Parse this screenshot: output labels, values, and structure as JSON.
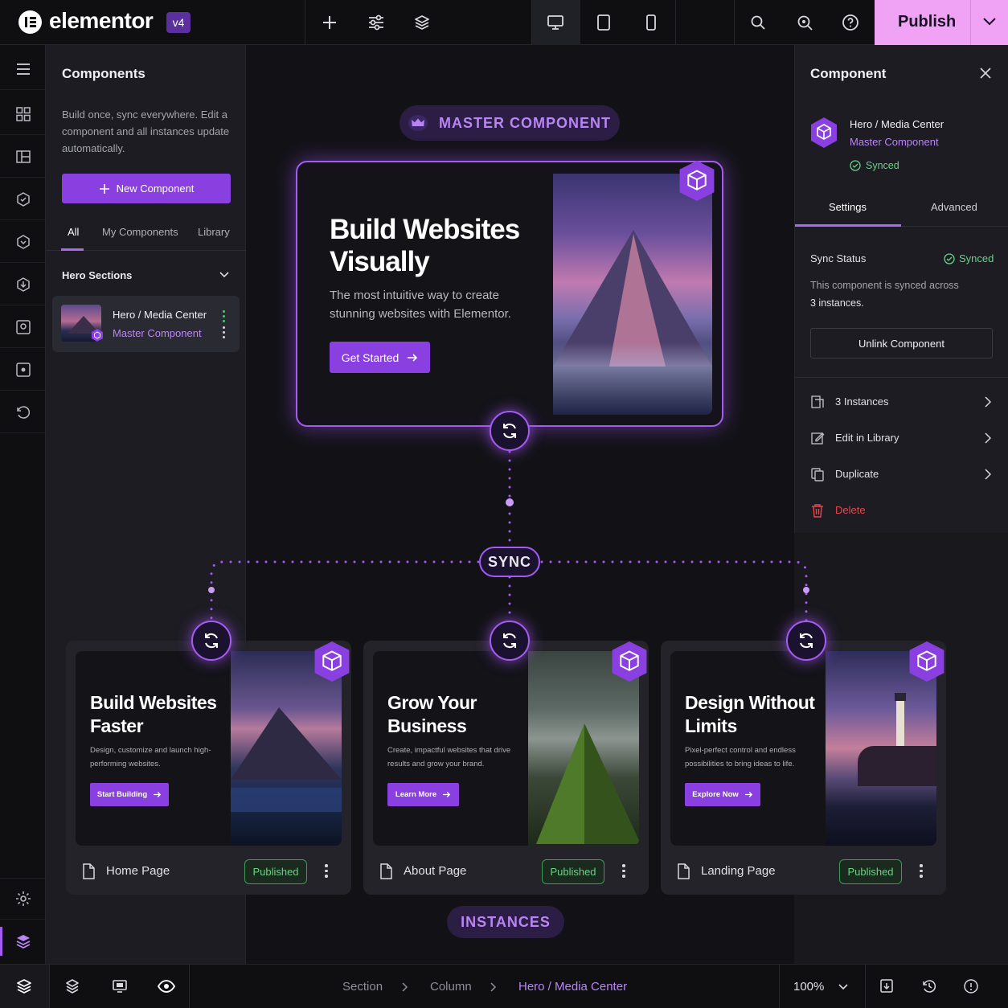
{
  "topbar": {
    "brand": "elementor",
    "version": "v4",
    "publish_label": "Publish"
  },
  "panel": {
    "title": "Components",
    "description": "Build once, sync everywhere. Edit a component and all instances update automatically.",
    "new_button": "New Component",
    "tabs": [
      "All",
      "My Components",
      "Library"
    ],
    "group": "Hero Sections",
    "component": {
      "name": "Hero / Media Center",
      "type": "Master Component"
    }
  },
  "canvas": {
    "master_pill": "MASTER COMPONENT",
    "sync_pill": "SYNC",
    "instances_pill": "INSTANCES",
    "master": {
      "title": "Build Websites Visually",
      "subtitle": "The most intuitive way to create stunning websites with Elementor.",
      "button": "Get Started"
    },
    "instances": [
      {
        "title": "Build Websites Faster",
        "subtitle": "Design, customize and launch high-performing websites.",
        "button": "Start Building",
        "page": "Home Page",
        "status": "Published"
      },
      {
        "title": "Grow Your Business",
        "subtitle": "Create, impactful websites that drive results and grow your brand.",
        "button": "Learn More",
        "page": "About Page",
        "status": "Published"
      },
      {
        "title": "Design Without Limits",
        "subtitle": "Pixel-perfect control and endless possibilities to bring ideas to life.",
        "button": "Explore Now",
        "page": "Landing Page",
        "status": "Published"
      }
    ]
  },
  "rpanel": {
    "title": "Component",
    "name": "Hero / Media Center",
    "type": "Master Component",
    "synced": "Synced",
    "tabs": [
      "Settings",
      "Advanced"
    ],
    "sync_status_label": "Sync Status",
    "sync_status_value": "Synced",
    "sync_desc": "This component is synced across",
    "sync_count": "3 instances.",
    "unlink": "Unlink Component",
    "actions": [
      "3 Instances",
      "Edit in Library",
      "Duplicate"
    ],
    "delete": "Delete"
  },
  "bottom": {
    "breadcrumbs": [
      "Section",
      "Column",
      "Hero / Media Center"
    ],
    "zoom": "100%"
  },
  "colors": {
    "accent": "#8a3fe0",
    "accent_light": "#b985f5",
    "publish": "#f0a3f5",
    "success": "#6bd187",
    "danger": "#e5484d"
  }
}
